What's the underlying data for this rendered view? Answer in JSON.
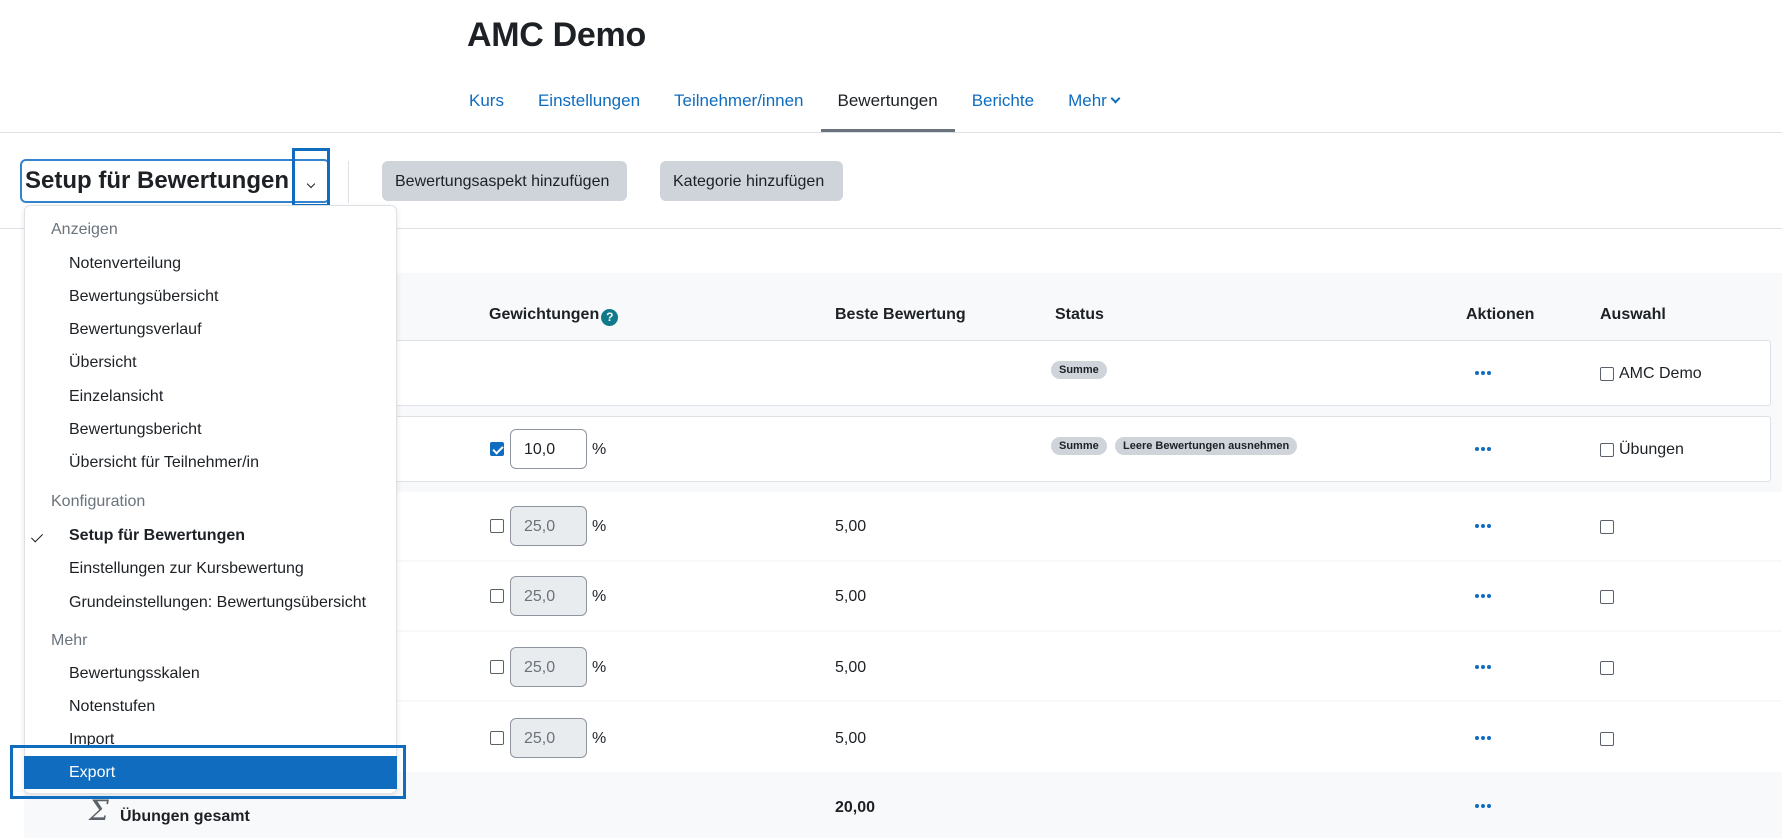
{
  "course": {
    "title": "AMC Demo"
  },
  "nav": {
    "items": [
      {
        "label": "Kurs"
      },
      {
        "label": "Einstellungen"
      },
      {
        "label": "Teilnehmer/innen"
      },
      {
        "label": "Bewertungen",
        "active": true
      },
      {
        "label": "Berichte"
      },
      {
        "label": "Mehr",
        "has_dropdown": true
      }
    ]
  },
  "action_bar": {
    "selector_label": "Setup für Bewertungen",
    "add_item_button": "Bewertungsaspekt hinzufügen",
    "add_category_button": "Kategorie hinzufügen"
  },
  "table": {
    "headers": {
      "weights": "Gewichtungen",
      "max_grade": "Beste Bewertung",
      "status": "Status",
      "actions": "Aktionen",
      "select": "Auswahl"
    },
    "weights_help_icon": "question-circle-icon",
    "actions_icon": "ellipsis-icon",
    "rows": [
      {
        "type": "course",
        "status_badges": [
          "Summe"
        ],
        "select_label": "AMC Demo"
      },
      {
        "type": "category",
        "weight_checked": true,
        "weight": "10,0",
        "weight_unit": "%",
        "status_badges": [
          "Summe",
          "Leere Bewertungen ausnehmen"
        ],
        "select_label": "Übungen"
      },
      {
        "type": "item",
        "weight_checked": false,
        "weight": "25,0",
        "weight_unit": "%",
        "max_grade": "5,00"
      },
      {
        "type": "item",
        "weight_checked": false,
        "weight": "25,0",
        "weight_unit": "%",
        "max_grade": "5,00"
      },
      {
        "type": "item",
        "weight_checked": false,
        "weight": "25,0",
        "weight_unit": "%",
        "max_grade": "5,00"
      },
      {
        "type": "item",
        "weight_checked": false,
        "weight": "25,0",
        "weight_unit": "%",
        "max_grade": "5,00"
      }
    ],
    "total": {
      "icon": "sigma-icon",
      "label": "Übungen gesamt",
      "value": "20,00"
    }
  },
  "dropdown": {
    "sections": [
      {
        "header": "Anzeigen",
        "items": [
          "Notenverteilung",
          "Bewertungsübersicht",
          "Bewertungsverlauf",
          "Übersicht",
          "Einzelansicht",
          "Bewertungsbericht",
          "Übersicht für Teilnehmer/in"
        ]
      },
      {
        "header": "Konfiguration",
        "items": [
          "Setup für Bewertungen",
          "Einstellungen zur Kursbewertung",
          "Grundeinstellungen: Bewertungsübersicht"
        ]
      },
      {
        "header": "Mehr",
        "items": [
          "Bewertungsskalen",
          "Notenstufen",
          "Import",
          "Export"
        ]
      }
    ],
    "current_item": "Setup für Bewertungen",
    "highlighted_item": "Export"
  },
  "colors": {
    "link": "#0f6cbf",
    "badge_bg": "#ced4da",
    "help_icon": "#0f7a8a",
    "table_bg": "#f8f9fa"
  }
}
